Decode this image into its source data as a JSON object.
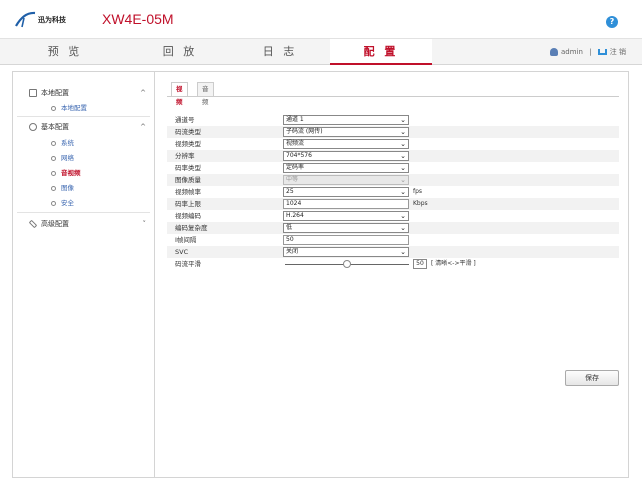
{
  "header": {
    "brand": "迅为科技",
    "model": "XW4E-05M",
    "help_icon": "question-circle-icon"
  },
  "nav": {
    "tabs": [
      "预 览",
      "回 放",
      "日 志",
      "配 置"
    ],
    "active": "配 置",
    "user": "admin",
    "separator": "|",
    "logout": "注 销"
  },
  "sidebar": {
    "groups": [
      {
        "label": "本地配置",
        "caret": "^",
        "icon": "monitor-icon",
        "items": [
          "本地配置"
        ]
      },
      {
        "label": "基本配置",
        "caret": "^",
        "icon": "gear-icon",
        "items": [
          "系统",
          "网络",
          "音视频",
          "图像",
          "安全"
        ],
        "active_item": "音视频"
      },
      {
        "label": "高级配置",
        "caret": "˅",
        "icon": "wrench-icon",
        "items": []
      }
    ]
  },
  "tabs": {
    "items": [
      "视频",
      "音频"
    ],
    "active": "视频"
  },
  "form": {
    "rows": [
      {
        "label": "通道号",
        "type": "select",
        "value": "通道 1"
      },
      {
        "label": "码流类型",
        "type": "select",
        "value": "子码流 (网传)"
      },
      {
        "label": "视频类型",
        "type": "select",
        "value": "视频流"
      },
      {
        "label": "分辨率",
        "type": "select",
        "value": "704*576"
      },
      {
        "label": "码率类型",
        "type": "select",
        "value": "定码率"
      },
      {
        "label": "图像质量",
        "type": "select",
        "value": "中等",
        "disabled": true
      },
      {
        "label": "视频帧率",
        "type": "select",
        "value": "25",
        "unit": "fps"
      },
      {
        "label": "码率上限",
        "type": "text",
        "value": "1024",
        "unit": "Kbps"
      },
      {
        "label": "视频编码",
        "type": "select",
        "value": "H.264"
      },
      {
        "label": "编码复杂度",
        "type": "select",
        "value": "低"
      },
      {
        "label": "I帧间隔",
        "type": "text",
        "value": "50"
      },
      {
        "label": "SVC",
        "type": "select",
        "value": "关闭"
      },
      {
        "label": "码流平滑",
        "type": "slider",
        "value": "50",
        "hint": "[ 清晰<->平滑 ]",
        "fraction": 0.5
      }
    ]
  },
  "save_label": "保存"
}
